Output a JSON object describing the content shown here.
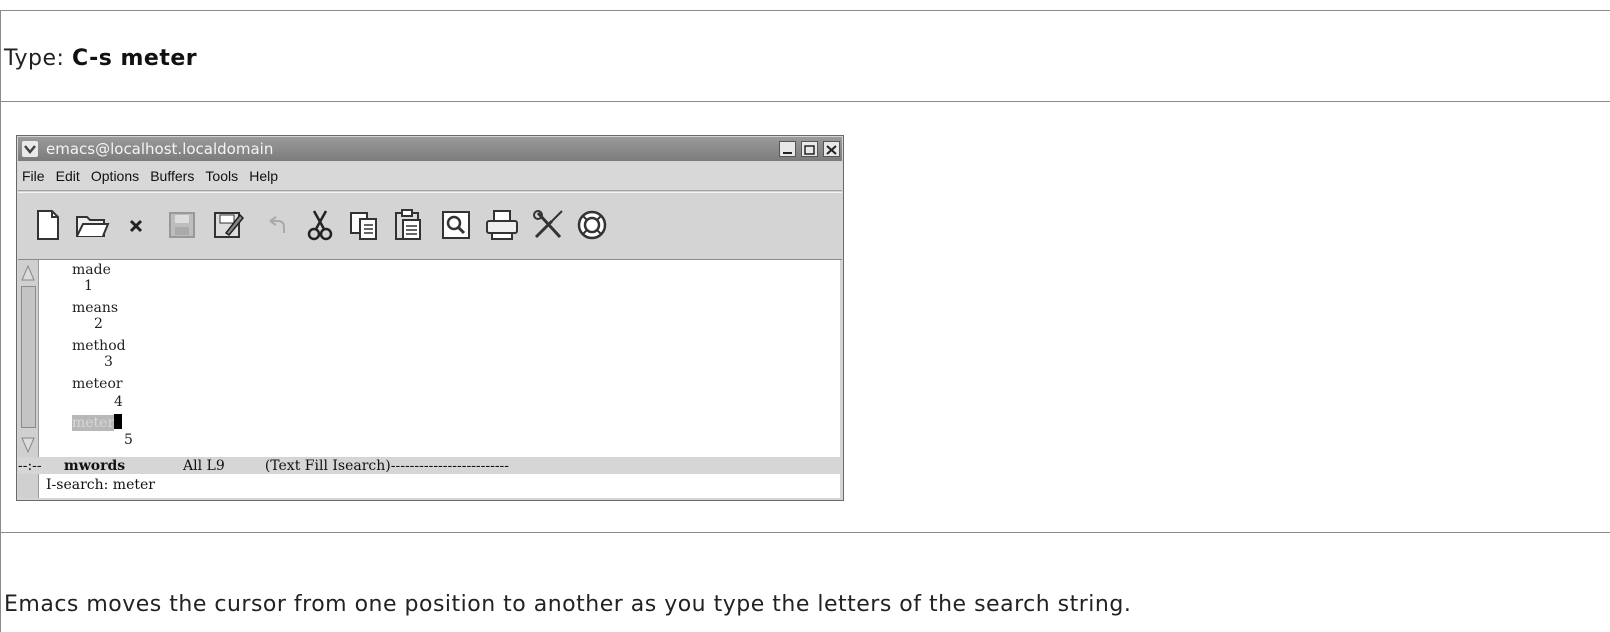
{
  "instruction": {
    "prefix": "Type: ",
    "keys": "C-s meter"
  },
  "caption": "Emacs moves the cursor from one position to another as you type the letters of the search string.",
  "window": {
    "title": "emacs@localhost.localdomain",
    "menu": [
      "File",
      "Edit",
      "Options",
      "Buffers",
      "Tools",
      "Help"
    ],
    "toolbar_icons": [
      "new-file-icon",
      "open-folder-icon",
      "close-icon",
      "save-icon",
      "save-as-icon",
      "undo-icon",
      "cut-icon",
      "copy-icon",
      "paste-icon",
      "search-icon",
      "print-icon",
      "preferences-icon",
      "help-icon"
    ]
  },
  "buffer": {
    "lines": [
      "made",
      "1",
      "means",
      "2",
      "method",
      "3",
      "meteor",
      "4",
      "meter",
      "5"
    ],
    "match_text": "meter"
  },
  "modeline": {
    "prefix": "--:-- ",
    "buffer_name": "mwords",
    "position": "All L9",
    "modes": "(Text Fill Isearch)",
    "dashes": "-------------------------"
  },
  "minibuffer": {
    "label": "I-search: ",
    "query": "meter"
  }
}
